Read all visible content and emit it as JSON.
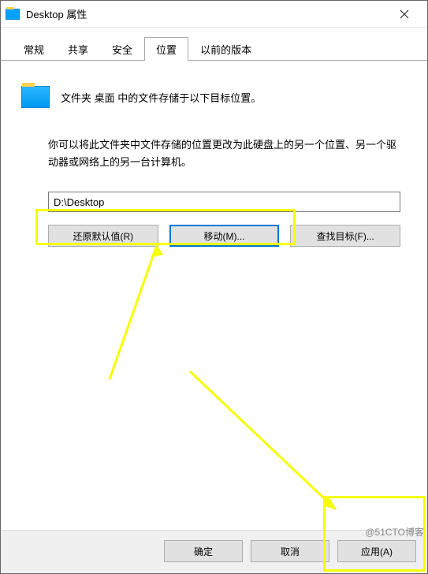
{
  "window": {
    "title": "Desktop 属性"
  },
  "tabs": {
    "general": "常规",
    "share": "共享",
    "security": "安全",
    "location": "位置",
    "previous": "以前的版本"
  },
  "location_tab": {
    "intro": "文件夹 桌面 中的文件存储于以下目标位置。",
    "explain": "你可以将此文件夹中文件存储的位置更改为此硬盘上的另一个位置、另一个驱动器或网络上的另一台计算机。",
    "path": "D:\\Desktop",
    "restore_btn": "还原默认值(R)",
    "move_btn": "移动(M)...",
    "find_btn": "查找目标(F)..."
  },
  "buttons": {
    "ok": "确定",
    "cancel": "取消",
    "apply": "应用(A)"
  },
  "watermark": "@51CTO博客"
}
